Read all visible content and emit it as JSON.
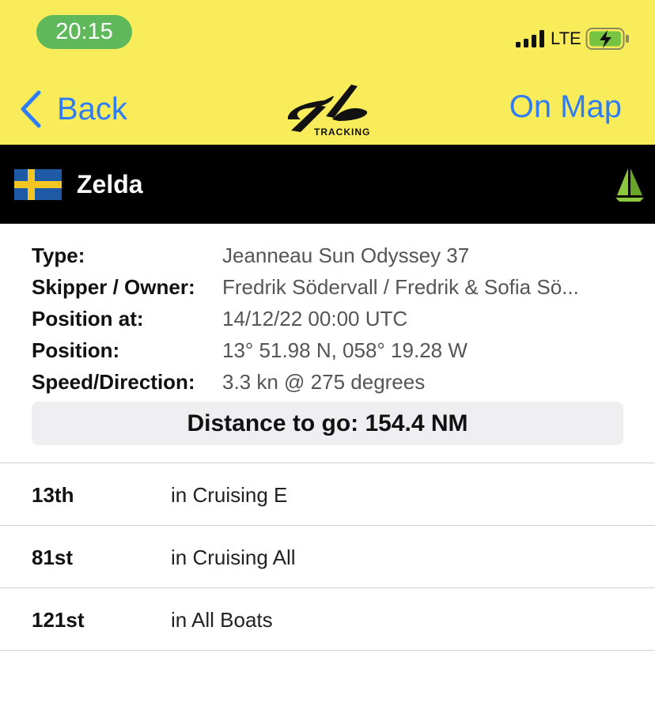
{
  "status_bar": {
    "time": "20:15",
    "network": "LTE"
  },
  "nav": {
    "back_label": "Back",
    "logo_text": "TRACKING",
    "map_label": "On Map"
  },
  "boat": {
    "name": "Zelda",
    "flag": "Sweden"
  },
  "details": [
    {
      "label": "Type:",
      "value": "Jeanneau Sun Odyssey 37"
    },
    {
      "label": "Skipper / Owner:",
      "value": "Fredrik Södervall / Fredrik & Sofia Sö..."
    },
    {
      "label": "Position at:",
      "value": "14/12/22 00:00 UTC"
    },
    {
      "label": "Position:",
      "value": "13° 51.98 N, 058° 19.28 W"
    },
    {
      "label": "Speed/Direction:",
      "value": "3.3 kn @ 275 degrees"
    }
  ],
  "distance": "Distance to go: 154.4 NM",
  "rankings": [
    {
      "position": "13th",
      "category": "in Cruising E"
    },
    {
      "position": "81st",
      "category": "in Cruising All"
    },
    {
      "position": "121st",
      "category": "in All Boats"
    }
  ],
  "colors": {
    "header_bg": "#f9ec5a",
    "accent_blue": "#2f7df6",
    "boat_bar_bg": "#000000",
    "time_pill": "#5fb85a",
    "sail_green": "#8dc63f"
  }
}
